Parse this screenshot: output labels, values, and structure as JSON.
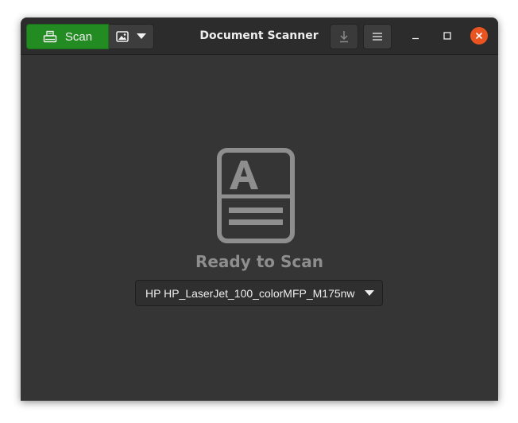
{
  "window": {
    "title": "Document Scanner"
  },
  "toolbar": {
    "scan_label": "Scan",
    "scan_icon": "scanner-icon",
    "type_icon": "image-icon",
    "save_icon": "download-icon",
    "menu_icon": "hamburger-menu-icon"
  },
  "window_controls": {
    "minimize_icon": "minimize-icon",
    "maximize_icon": "maximize-icon",
    "close_icon": "close-icon"
  },
  "main": {
    "status": "Ready to Scan",
    "placeholder_icon": "document-icon",
    "device": "HP HP_LaserJet_100_colorMFP_M175nw"
  },
  "colors": {
    "scan_button": "#228b22",
    "close_button": "#e95420",
    "background": "#353535",
    "headerbar": "#2c2c2c"
  }
}
